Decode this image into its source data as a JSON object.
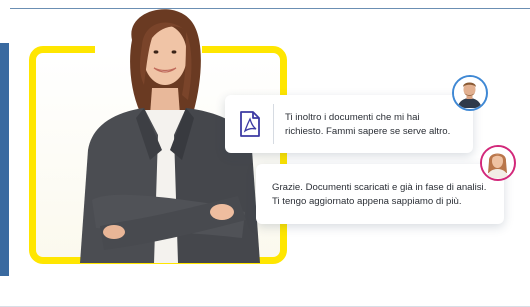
{
  "colors": {
    "accent_yellow": "#ffe600",
    "side_bar": "#3a6aa0",
    "pdf_icon": "#3c3aa3",
    "avatar1_ring": "#3f88d4",
    "avatar2_ring": "#d2287a"
  },
  "illustration": {
    "person_icon": "businesswoman-photo"
  },
  "messages": [
    {
      "icon": "pdf-file-icon",
      "avatar": "man-avatar",
      "line1": "Ti inoltro i documenti che mi hai",
      "line2": "richiesto. Fammi sapere se serve altro."
    },
    {
      "avatar": "woman-avatar",
      "line1": "Grazie. Documenti scaricati e già in fase di analisi.",
      "line2": "Ti tengo aggiornato appena sappiamo di più."
    }
  ]
}
